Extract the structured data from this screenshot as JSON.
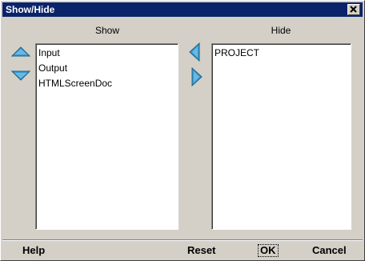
{
  "window": {
    "title": "Show/Hide"
  },
  "show": {
    "label": "Show",
    "items": [
      "Input",
      "Output",
      "HTMLScreenDoc"
    ]
  },
  "hide": {
    "label": "Hide",
    "items": [
      "PROJECT"
    ]
  },
  "footer": {
    "help_label": "Help",
    "reset_label": "Reset",
    "ok_label": "OK",
    "cancel_label": "Cancel"
  },
  "colors": {
    "titlebar": "#0a246a",
    "arrow": "#3a9bd0",
    "face": "#d4d0c8"
  }
}
